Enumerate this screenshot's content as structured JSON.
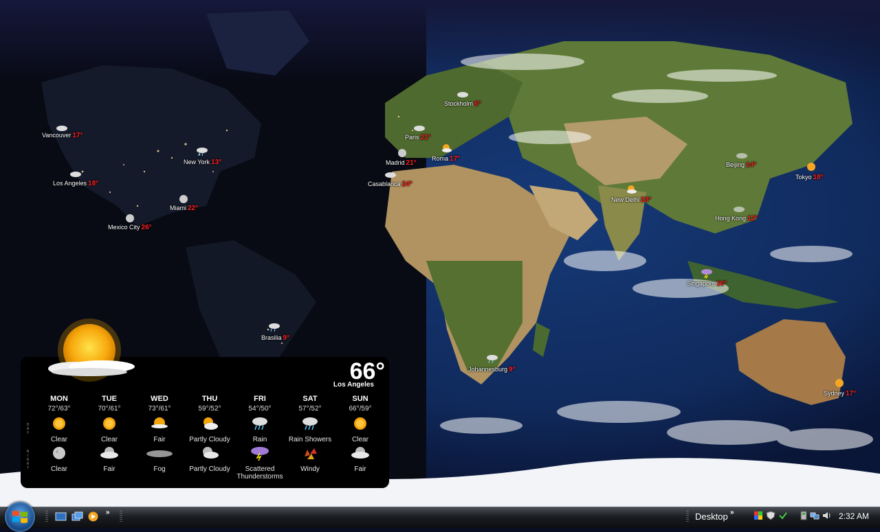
{
  "cities": [
    {
      "name": "Vancouver",
      "temp": "17°",
      "icon": "cloudy-night-icon"
    },
    {
      "name": "New York",
      "temp": "13°",
      "icon": "rain-icon"
    },
    {
      "name": "Los Angeles",
      "temp": "18°",
      "icon": "cloudy-night-icon"
    },
    {
      "name": "Miami",
      "temp": "22°",
      "icon": "moon-icon"
    },
    {
      "name": "Mexico City",
      "temp": "26°",
      "icon": "moon-icon"
    },
    {
      "name": "Brasilia",
      "temp": "9°",
      "icon": "rain-icon"
    },
    {
      "name": "Stockholm",
      "temp": "6°",
      "icon": "cloud-icon"
    },
    {
      "name": "Paris",
      "temp": "21°",
      "icon": "cloud-icon"
    },
    {
      "name": "Madrid",
      "temp": "21°",
      "icon": "moon-icon"
    },
    {
      "name": "Roma",
      "temp": "17°",
      "icon": "partly-cloudy-icon"
    },
    {
      "name": "Casablanca",
      "temp": "24°",
      "icon": "cloud-icon"
    },
    {
      "name": "Johannesburg",
      "temp": "9°",
      "icon": "rain-icon"
    },
    {
      "name": "New Delhi",
      "temp": "23°",
      "icon": "partly-cloudy-icon"
    },
    {
      "name": "Beijing",
      "temp": "14°",
      "icon": "cloud-icon"
    },
    {
      "name": "Tokyo",
      "temp": "18°",
      "icon": "sun-icon"
    },
    {
      "name": "Hong Kong",
      "temp": "12°",
      "icon": "cloud-icon"
    },
    {
      "name": "Singapore",
      "temp": "10°",
      "icon": "thunderstorm-icon"
    },
    {
      "name": "Sydney",
      "temp": "17°",
      "icon": "sun-icon"
    }
  ],
  "widget": {
    "current_temp": "66°",
    "current_city": "Los Angeles",
    "day_label": "DAY",
    "night_label": "NIGHT",
    "days": [
      {
        "name": "MON",
        "range": "72°/63°",
        "day_icon": "sun-icon",
        "day_cond": "Clear",
        "night_icon": "moon-icon",
        "night_cond": "Clear"
      },
      {
        "name": "TUE",
        "range": "70°/61°",
        "day_icon": "sun-icon",
        "day_cond": "Clear",
        "night_icon": "cloudy-night-icon",
        "night_cond": "Fair"
      },
      {
        "name": "WED",
        "range": "73°/61°",
        "day_icon": "fair-icon",
        "day_cond": "Fair",
        "night_icon": "fog-icon",
        "night_cond": "Fog"
      },
      {
        "name": "THU",
        "range": "59°/52°",
        "day_icon": "partly-cloudy-icon",
        "day_cond": "Partly Cloudy",
        "night_icon": "cloudy-night-icon",
        "night_cond": "Partly Cloudy"
      },
      {
        "name": "FRI",
        "range": "54°/50°",
        "day_icon": "rain-icon",
        "day_cond": "Rain",
        "night_icon": "thunderstorm-icon",
        "night_cond": "Scattered Thunderstorms"
      },
      {
        "name": "SAT",
        "range": "57°/52°",
        "day_icon": "rain-icon",
        "day_cond": "Rain Showers",
        "night_icon": "windy-icon",
        "night_cond": "Windy"
      },
      {
        "name": "SUN",
        "range": "66°/59°",
        "day_icon": "sun-icon",
        "day_cond": "Clear",
        "night_icon": "cloudy-night-icon",
        "night_cond": "Fair"
      }
    ]
  },
  "taskbar": {
    "desktop_label": "Desktop",
    "clock": "2:32 AM",
    "quick_launch": [
      "show-desktop-icon",
      "switch-windows-icon",
      "media-player-icon"
    ],
    "tray": [
      "color-flag-icon",
      "shield-icon",
      "security-check-icon",
      "usb-icon",
      "network-icon",
      "volume-icon"
    ]
  },
  "colors": {
    "temp_red": "#ff2020",
    "widget_bg": "#000000",
    "taskbar": "#1b1e22"
  }
}
